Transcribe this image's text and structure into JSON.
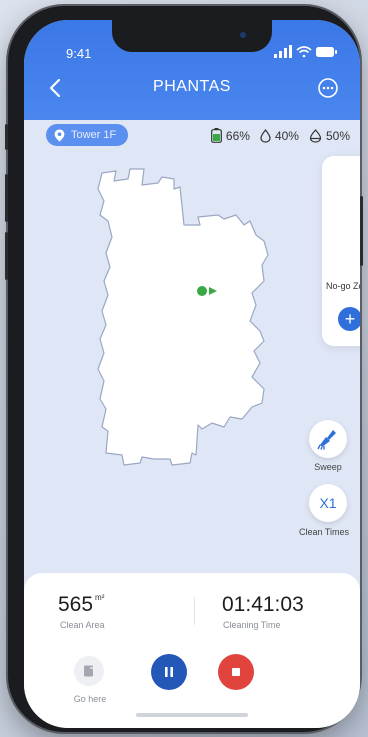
{
  "status_bar": {
    "time": "9:41"
  },
  "topbar": {
    "title": "PHANTAS"
  },
  "location": {
    "label": "Tower 1F"
  },
  "stats": {
    "battery": "66%",
    "water_1": "40%",
    "water_2": "50%"
  },
  "side_panel": {
    "nogo_label": "No-go Zo",
    "add_label": "+"
  },
  "actions": {
    "sweep_label": "Sweep",
    "clean_times_value": "X1",
    "clean_times_label": "Clean Times"
  },
  "summary": {
    "clean_area_value": "565",
    "clean_area_unit": "m²",
    "clean_area_label": "Clean Area",
    "cleaning_time_value": "01:41:03",
    "cleaning_time_label": "Cleaning Time"
  },
  "controls": {
    "go_here_label": "Go here"
  },
  "colors": {
    "header_blue": "#3b78e7",
    "pause_blue": "#2358b8",
    "stop_red": "#e0443c",
    "robot_green": "#3aa845",
    "map_background": "#dfe6f5"
  }
}
